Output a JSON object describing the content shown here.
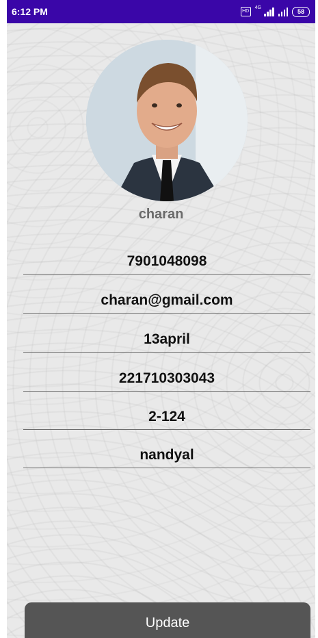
{
  "status_bar": {
    "time": "6:12 PM",
    "volte_icon": "volte-icon",
    "network_label": "4G",
    "battery": "58"
  },
  "profile": {
    "avatar_icon": "profile-photo",
    "name": "charan"
  },
  "fields": {
    "phone": "7901048098",
    "email": "charan@gmail.com",
    "dob": "13april",
    "roll_number": "221710303043",
    "door_no": "2-124",
    "city": "nandyal"
  },
  "actions": {
    "update_label": "Update"
  },
  "colors": {
    "status_bar": "#3a06a8",
    "button": "#555555",
    "text": "#111111"
  }
}
